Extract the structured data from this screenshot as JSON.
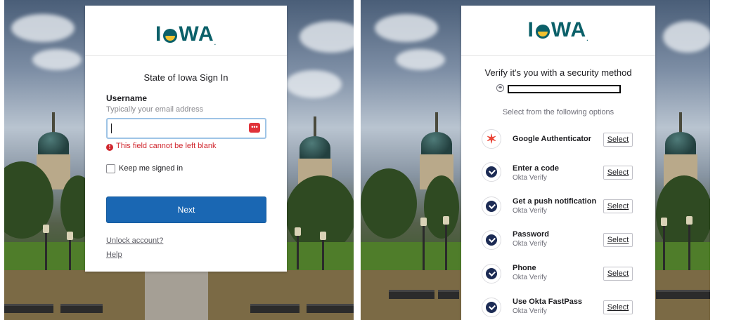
{
  "brand": {
    "logo": "IOWA",
    "colors": {
      "teal": "#0b6069",
      "gold": "#f2c230",
      "primary_button": "#1a67b3",
      "error": "#d0262d"
    }
  },
  "login": {
    "title": "State of Iowa Sign In",
    "username_label": "Username",
    "username_hint": "Typically your email address",
    "username_value": "",
    "error": "This field cannot be left blank",
    "keep_signed_in": "Keep me signed in",
    "next_button": "Next",
    "unlock_link": "Unlock account?",
    "help_link": "Help"
  },
  "verify": {
    "title": "Verify it's you with a security method",
    "subtitle": "Select from the following options",
    "options": [
      {
        "title": "Google Authenticator",
        "subtitle": "",
        "icon": "google-authenticator-icon",
        "button": "Select"
      },
      {
        "title": "Enter a code",
        "subtitle": "Okta Verify",
        "icon": "okta-verify-icon",
        "button": "Select"
      },
      {
        "title": "Get a push notification",
        "subtitle": "Okta Verify",
        "icon": "okta-verify-icon",
        "button": "Select"
      },
      {
        "title": "Password",
        "subtitle": "Okta Verify",
        "icon": "okta-verify-icon",
        "button": "Select"
      },
      {
        "title": "Phone",
        "subtitle": "Okta Verify",
        "icon": "okta-verify-icon",
        "button": "Select"
      },
      {
        "title": "Use Okta FastPass",
        "subtitle": "Okta Verify",
        "icon": "okta-verify-icon",
        "button": "Select"
      }
    ]
  }
}
